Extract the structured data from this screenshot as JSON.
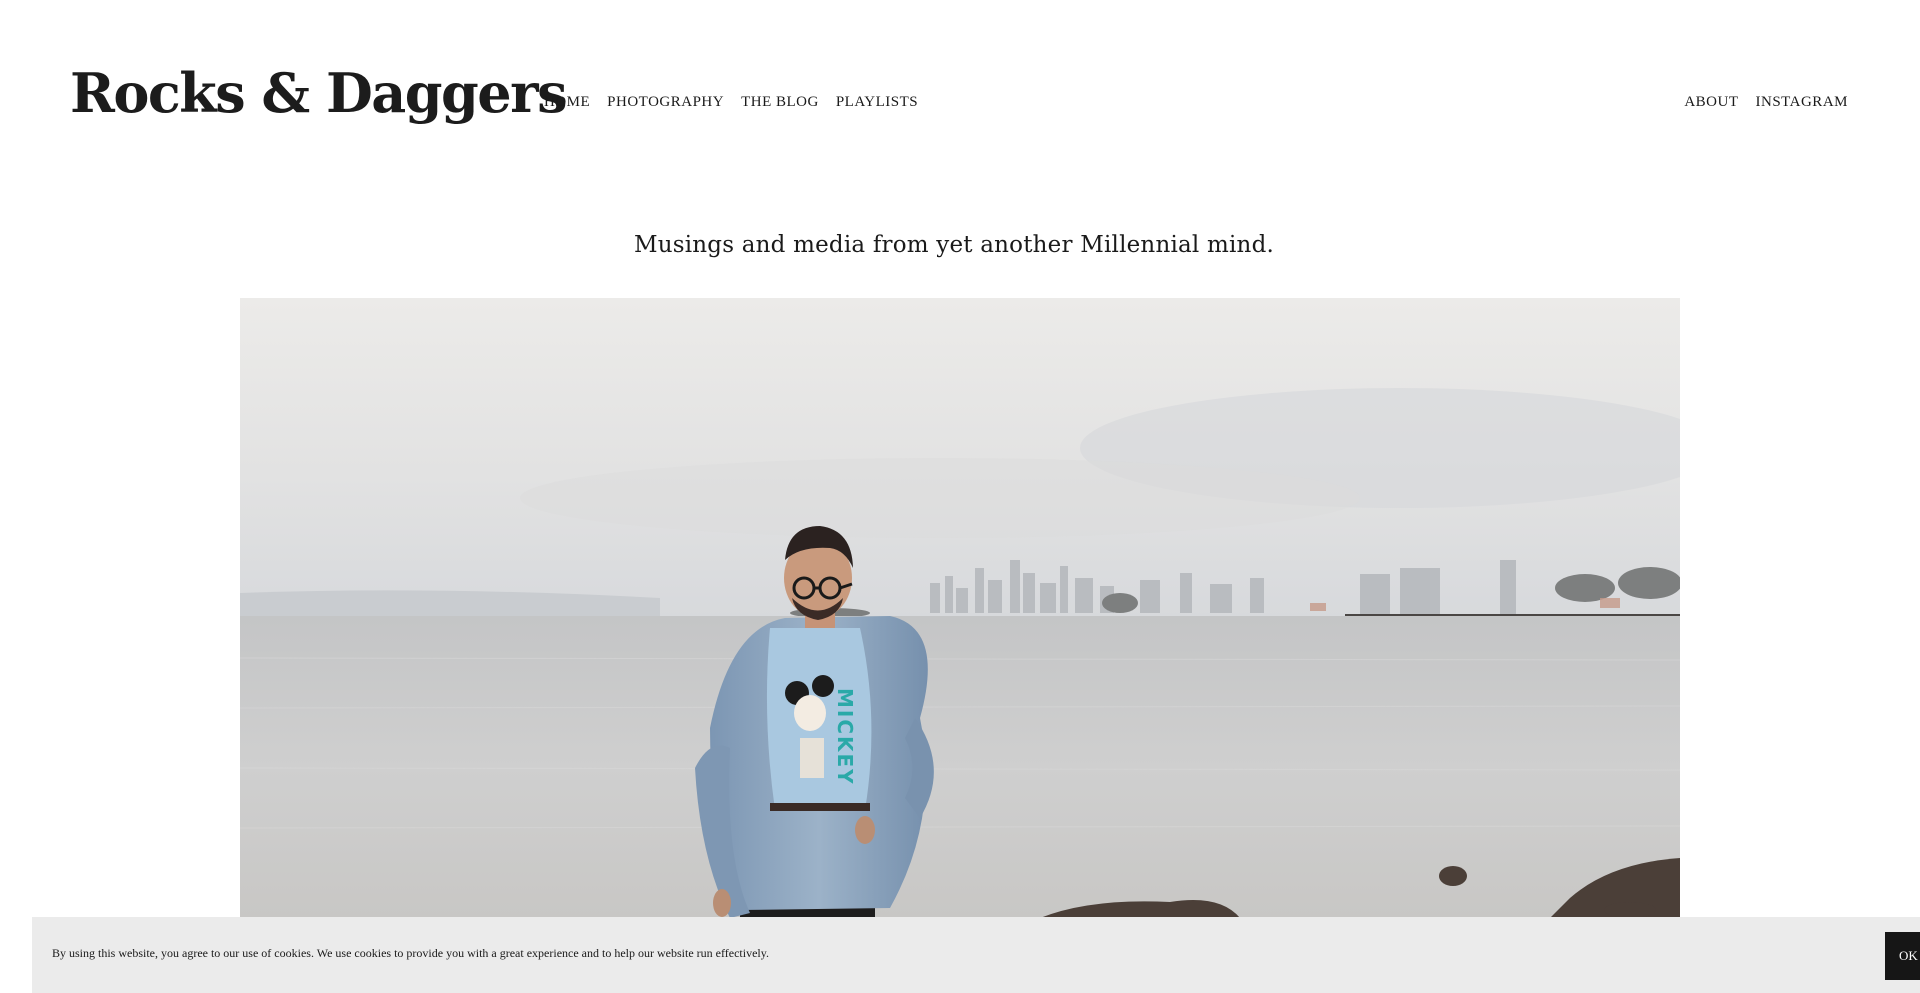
{
  "site": {
    "title": "Rocks & Daggers",
    "tagline": "Musings and media from yet another Millennial mind."
  },
  "nav": {
    "main": [
      "HOME",
      "PHOTOGRAPHY",
      "THE BLOG",
      "PLAYLISTS"
    ],
    "secondary": [
      "ABOUT",
      "INSTAGRAM"
    ]
  },
  "hero": {
    "tshirt_text": "MICKEY"
  },
  "cookie_banner": {
    "text": "By using this website, you agree to our use of cookies. We use cookies to provide you with a great experience and to help our website run effectively.",
    "button_label": "OK"
  },
  "colors": {
    "text": "#1a1a1a",
    "banner_bg": "#ebebeb",
    "button_bg": "#161616"
  }
}
